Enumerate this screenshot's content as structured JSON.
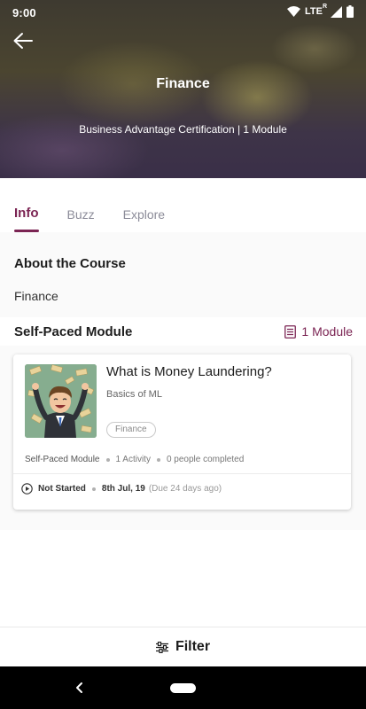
{
  "status_bar": {
    "time": "9:00",
    "network": "LTE",
    "network_sup": "R"
  },
  "header": {
    "title": "Finance",
    "subtitle": "Business Advantage Certification | 1 Module"
  },
  "tabs": [
    {
      "label": "Info",
      "active": true
    },
    {
      "label": "Buzz",
      "active": false
    },
    {
      "label": "Explore",
      "active": false
    }
  ],
  "about": {
    "heading": "About the Course",
    "text": "Finance"
  },
  "modules": {
    "heading": "Self-Paced Module",
    "count_label": "1 Module"
  },
  "card": {
    "title": "What is Money Laundering?",
    "subtitle": "Basics of ML",
    "tag": "Finance",
    "meta": {
      "type": "Self-Paced Module",
      "activities": "1 Activity",
      "completed": "0 people completed"
    },
    "status": "Not Started",
    "date": "8th Jul, 19",
    "due": "(Due 24 days ago)"
  },
  "filter": {
    "label": "Filter"
  },
  "colors": {
    "accent": "#7b2453",
    "tab_inactive": "#8c8c99"
  }
}
